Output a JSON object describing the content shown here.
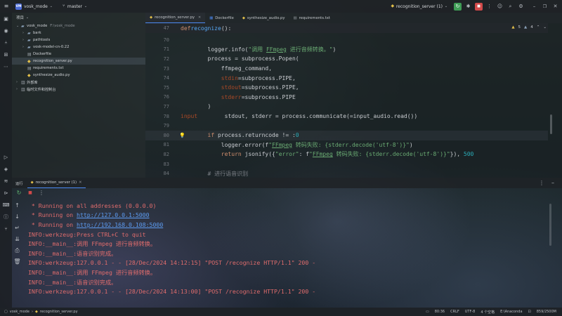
{
  "titlebar": {
    "project_badge": "VM",
    "project_name": "vosk_mode",
    "branch": "master",
    "run_config": "recognition_server (1)"
  },
  "project_panel": {
    "title": "项目",
    "items": [
      {
        "indent": 0,
        "name": "vosk_mode",
        "hint": "F:\\vosk_mode",
        "kind": "folder",
        "open": true
      },
      {
        "indent": 1,
        "name": "bark",
        "kind": "folder"
      },
      {
        "indent": 1,
        "name": "pathtools",
        "kind": "folder"
      },
      {
        "indent": 1,
        "name": "vosk-model-cn-0.22",
        "kind": "folder"
      },
      {
        "indent": 1,
        "name": "Dockerfile",
        "kind": "file"
      },
      {
        "indent": 1,
        "name": "recognition_server.py",
        "kind": "py",
        "selected": true
      },
      {
        "indent": 1,
        "name": "requirements.txt",
        "kind": "file"
      },
      {
        "indent": 1,
        "name": "synthesize_audio.py",
        "kind": "py"
      },
      {
        "indent": 0,
        "name": "外部库",
        "kind": "lib"
      },
      {
        "indent": 0,
        "name": "临时文件和控制台",
        "kind": "lib"
      }
    ]
  },
  "tabs": [
    {
      "label": "recognition_server.py",
      "active": true
    },
    {
      "label": "Dockerfile"
    },
    {
      "label": "synthesize_audio.py"
    },
    {
      "label": "requirements.txt"
    }
  ],
  "editor": {
    "sticky_line": "47",
    "sticky_def": "def",
    "sticky_fn": "recognize",
    "sticky_rest": "():",
    "inspections": {
      "warnings": "5",
      "weak": "4"
    },
    "lines": [
      {
        "n": "70",
        "text": ""
      },
      {
        "n": "71",
        "p1": "        logger.info(",
        "s1": "\"调用 ",
        "u1": "FFmpeg",
        "s2": " 进行音频转换。\"",
        "p2": ")"
      },
      {
        "n": "72",
        "p1": "        process = subprocess.Popen("
      },
      {
        "n": "73",
        "p1": "            ffmpeg_command,"
      },
      {
        "n": "74",
        "a1": "            stdin",
        "p1": "=subprocess.PIPE,"
      },
      {
        "n": "75",
        "a1": "            stdout",
        "p1": "=subprocess.PIPE,"
      },
      {
        "n": "76",
        "a1": "            stderr",
        "p1": "=subprocess.PIPE"
      },
      {
        "n": "77",
        "p1": "        )"
      },
      {
        "n": "78",
        "p1": "        stdout, stderr = process.communicate(",
        "a1": "input",
        "p2": "=input_audio.read())"
      },
      {
        "n": "79",
        "text": ""
      },
      {
        "n": "80",
        "k1": "        if",
        "p1": " process.returncode != ",
        "num": "0",
        "p2": ":"
      },
      {
        "n": "81",
        "p1": "            logger.error(f",
        "s1": "\"",
        "u1": "FFmpeg",
        "s2": " 转码失败: {stderr.decode('utf-8')}\"",
        "p2": ")"
      },
      {
        "n": "82",
        "k1": "            return",
        "p1": " jsonify({",
        "s1": "\"error\"",
        "p2": ": f",
        "s2": "\"",
        "u1": "FFmpeg",
        "s3": " 转码失败: {stderr.decode('utf-8')}\"",
        "p3": "}), ",
        "num": "500"
      },
      {
        "n": "83",
        "text": ""
      },
      {
        "n": "84",
        "c1": "        # 进行语音识别"
      }
    ]
  },
  "run_panel": {
    "title": "运行",
    "tab": "recognition_server (1)"
  },
  "console": [
    {
      "type": "bullet",
      "text": " * Running on all addresses (0.0.0.0)"
    },
    {
      "type": "link",
      "prefix": " * Running on ",
      "url": "http://127.0.0.1:5000"
    },
    {
      "type": "link",
      "prefix": " * Running on ",
      "url": "http://192.168.0.108:5000"
    },
    {
      "type": "plain",
      "text": "INFO:werkzeug:Press CTRL+C to quit"
    },
    {
      "type": "plain",
      "text": "INFO:__main__:调用 FFmpeg 进行音频转换。"
    },
    {
      "type": "plain",
      "text": "INFO:__main__:语音识别完成。"
    },
    {
      "type": "plain",
      "text": "INFO:werkzeug:127.0.0.1 - - [28/Dec/2024 14:12:15] \"POST /recognize HTTP/1.1\" 200 -"
    },
    {
      "type": "plain",
      "text": "INFO:__main__:调用 FFmpeg 进行音频转换。"
    },
    {
      "type": "plain",
      "text": "INFO:__main__:语音识别完成。"
    },
    {
      "type": "plain",
      "text": "INFO:werkzeug:127.0.0.1 - - [28/Dec/2024 14:13:00] \"POST /recognize HTTP/1.1\" 200 -"
    }
  ],
  "statusbar": {
    "crumb_project": "vosk_mode",
    "crumb_file": "recognition_server.py",
    "position": "80:36",
    "line_sep": "CRLF",
    "encoding": "UTF-8",
    "indent": "4 个空格",
    "interpreter": "E:\\Anaconda",
    "memory": "859/2500M"
  }
}
